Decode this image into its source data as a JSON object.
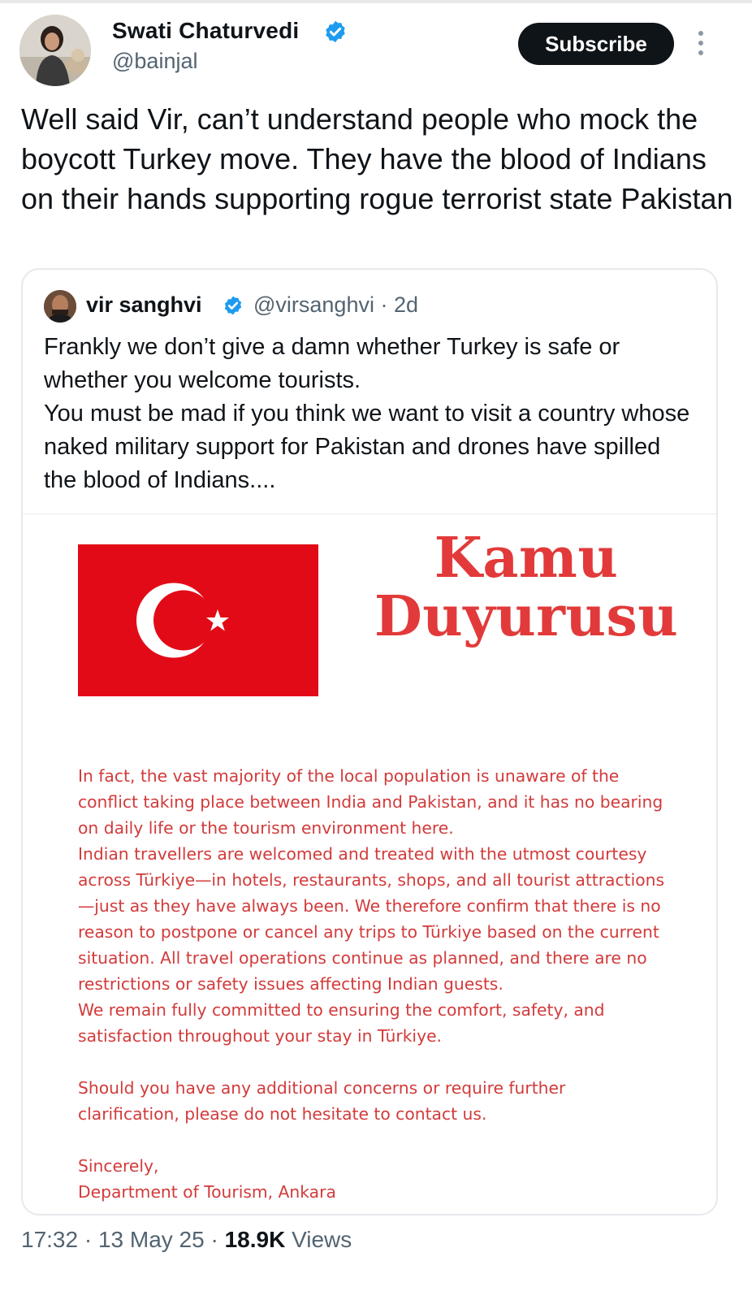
{
  "header": {
    "author_name": "Swati Chaturvedi",
    "author_handle": "@bainjal",
    "subscribe_label": "Subscribe",
    "more_icon": "more-vertical-icon"
  },
  "tweet": {
    "text": "Well said Vir, can’t understand people who mock the boycott Turkey move. They have the blood of Indians on their hands supporting rogue terrorist state Pakistan"
  },
  "quote": {
    "author_name": "vir sanghvi",
    "handle": "@virsanghvi",
    "time": "· 2d",
    "text_line1": "Frankly we don’t give a damn whether Turkey is safe or whether you welcome tourists.",
    "text_line2": "You must be mad if you think we want to visit a country whose naked military support for Pakistan and  drones have spilled the blood of Indians....",
    "media": {
      "title_line1": "Kamu",
      "title_line2": "Duyurusu",
      "notice_lines": [
        " In fact, the vast majority of the local population is unaware of the",
        "conflict taking place between India and Pakistan, and it has no bearing",
        "on daily life or the tourism environment here.",
        "Indian travellers are welcomed and treated with the utmost courtesy",
        "across Türkiye—in hotels, restaurants, shops, and all tourist attractions",
        "—just as they have always been. We therefore confirm that there is no",
        "reason to postpone or cancel any trips to Türkiye based on the current",
        "situation. All travel operations continue as planned, and there are no",
        "restrictions or safety issues affecting Indian guests.",
        "We remain fully committed to ensuring the comfort, safety, and",
        "satisfaction throughout your stay in Türkiye."
      ],
      "notice_lines_2": [
        " Should you have any additional concerns or require further",
        "clarification, please do not hesitate to contact us."
      ],
      "sign_off": "Sincerely,",
      "signature": "Department of Tourism, Ankara"
    }
  },
  "footer": {
    "time_date": "17:32 · 13 May 25 · ",
    "views_count": "18.9K",
    "views_label": " Views"
  },
  "colors": {
    "verified_blue": "#1d9bf0",
    "notice_red": "#d23b3b",
    "flag_red": "#e30a17",
    "subscribe_bg": "#0f1419"
  }
}
